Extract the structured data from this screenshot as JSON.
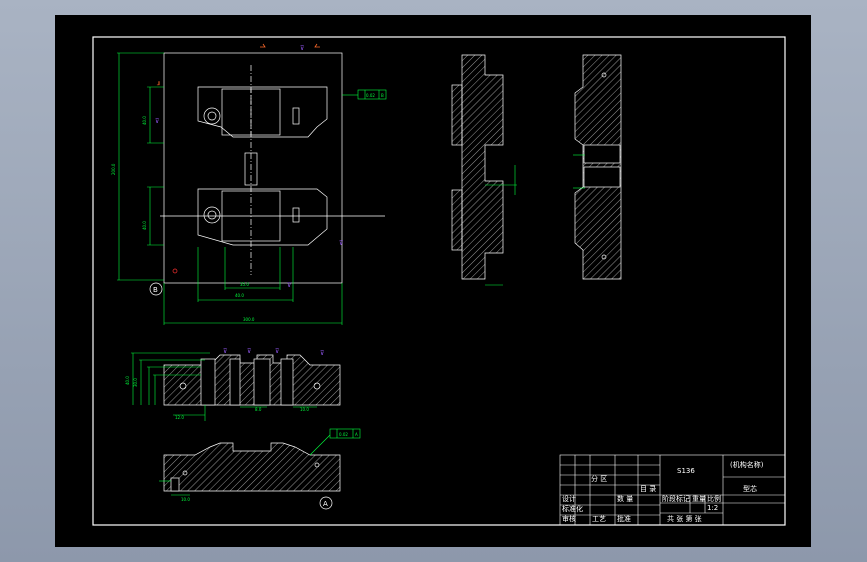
{
  "drawing": {
    "view_labels": {
      "view_b": "B",
      "view_a": "A"
    },
    "tolerance_frames": {
      "top_right": "0.02",
      "bottom": "0.02"
    },
    "datum_letters": {
      "top_right": "B",
      "bottom": "A"
    },
    "scale": "1:2"
  },
  "title_block": {
    "drawing_number": "S136",
    "part_name": "(机构名称)",
    "part_title": "型芯",
    "cells": {
      "fen_qu": "分 区",
      "sheet_count": "共 张 第 张",
      "shu_liang": "数 量",
      "mu_lu": "目 录",
      "jie_duan": "阶段标记",
      "zhong_liang": "重量",
      "bi_li": "比例",
      "she_ji": "设计",
      "biao_zhun": "标准化",
      "shen_he": "审核",
      "gong_yi": "工艺",
      "pi_zhun": "批准"
    }
  },
  "colors": {
    "background": "#000000",
    "frame": "#ffffff",
    "dimension": "#00ff3c",
    "annotation": "#ff3030",
    "marker": "#9b5cff",
    "hatch": "#ffffff"
  }
}
